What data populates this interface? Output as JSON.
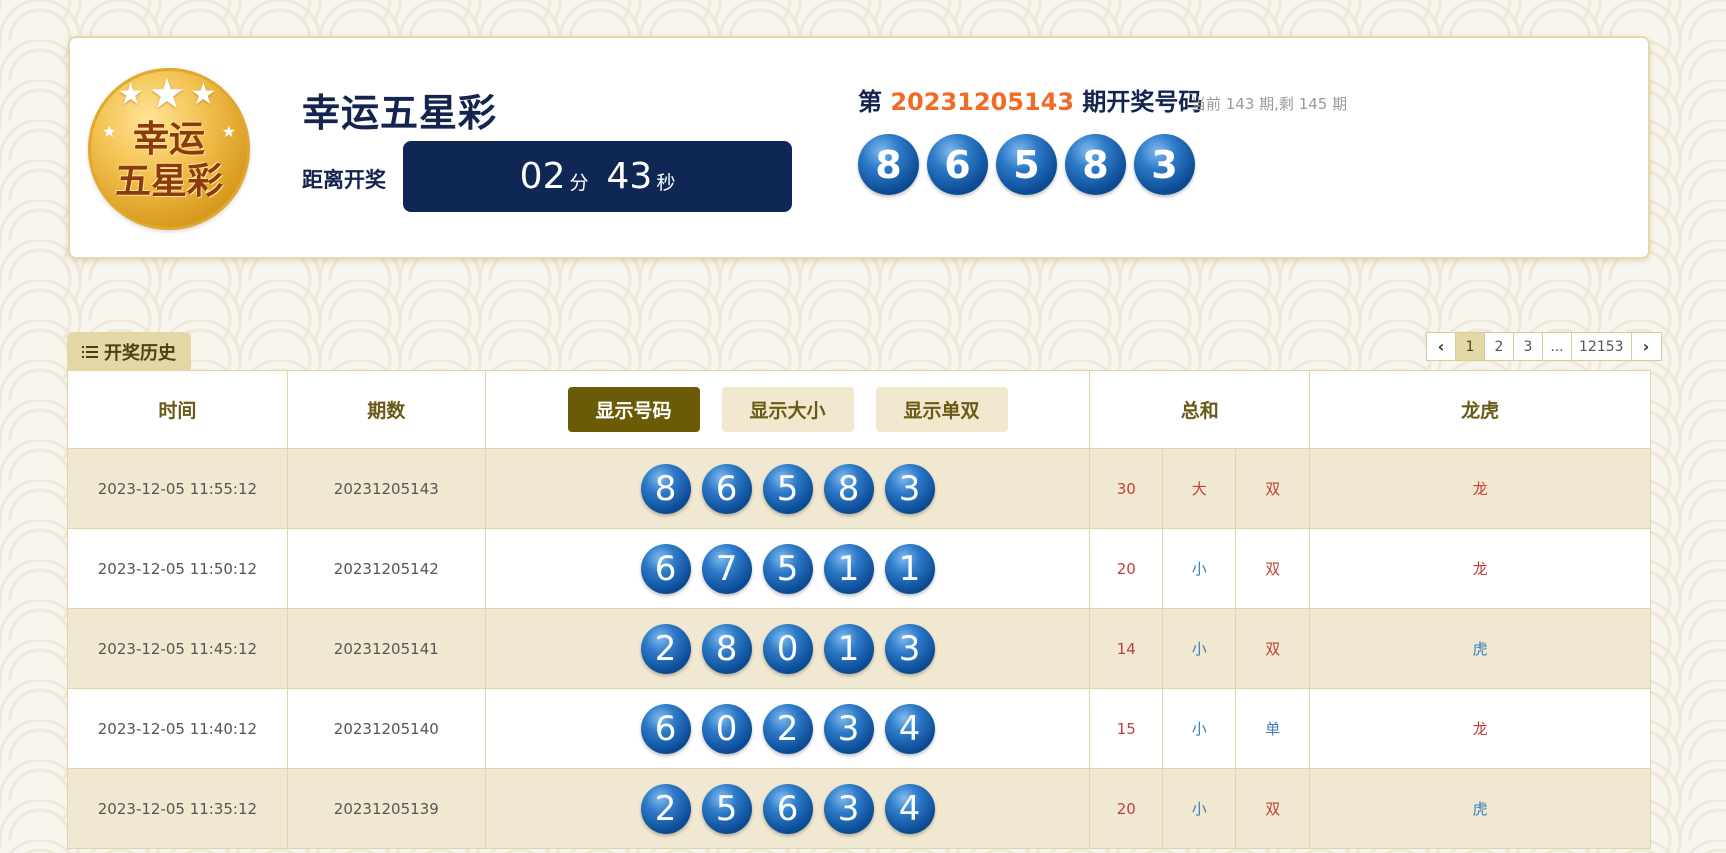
{
  "header": {
    "logo_text_line1": "幸运",
    "logo_text_line2": "五星彩",
    "title": "幸运五星彩",
    "countdown_label": "距离开奖",
    "countdown": {
      "minutes": "02",
      "minutes_unit": "分",
      "seconds": "43",
      "seconds_unit": "秒"
    },
    "draw_prefix": "第",
    "draw_issue": "20231205143",
    "draw_suffix": "期开奖号码",
    "draw_note": "当前 143 期,剩 145 期",
    "balls": [
      "8",
      "6",
      "5",
      "8",
      "3"
    ]
  },
  "history": {
    "tab_label": "开奖历史",
    "pagination": {
      "prev": "‹",
      "pages": [
        "1",
        "2",
        "3",
        "...",
        "12153"
      ],
      "active": "1",
      "next": "›"
    }
  },
  "table": {
    "headers": {
      "time": "时间",
      "issue": "期数",
      "btn_numbers": "显示号码",
      "btn_size": "显示大小",
      "btn_parity": "显示单双",
      "sum": "总和",
      "dragon_tiger": "龙虎"
    },
    "rows": [
      {
        "time": "2023-12-05 11:55:12",
        "issue": "20231205143",
        "balls": [
          "8",
          "6",
          "5",
          "8",
          "3"
        ],
        "sum": "30",
        "size": "大",
        "parity": "双",
        "dt": "龙"
      },
      {
        "time": "2023-12-05 11:50:12",
        "issue": "20231205142",
        "balls": [
          "6",
          "7",
          "5",
          "1",
          "1"
        ],
        "sum": "20",
        "size": "小",
        "parity": "双",
        "dt": "龙"
      },
      {
        "time": "2023-12-05 11:45:12",
        "issue": "20231205141",
        "balls": [
          "2",
          "8",
          "0",
          "1",
          "3"
        ],
        "sum": "14",
        "size": "小",
        "parity": "双",
        "dt": "虎"
      },
      {
        "time": "2023-12-05 11:40:12",
        "issue": "20231205140",
        "balls": [
          "6",
          "0",
          "2",
          "3",
          "4"
        ],
        "sum": "15",
        "size": "小",
        "parity": "单",
        "dt": "龙"
      },
      {
        "time": "2023-12-05 11:35:12",
        "issue": "20231205139",
        "balls": [
          "2",
          "5",
          "6",
          "3",
          "4"
        ],
        "sum": "20",
        "size": "小",
        "parity": "双",
        "dt": "虎"
      }
    ]
  },
  "colors": {
    "navy": "#0f2754",
    "gold_tab": "#e4d7a6",
    "active_button": "#6b5a06",
    "issue_orange": "#f26b24",
    "red_value": "#c43c3c",
    "blue_value": "#3a7fb8",
    "ball_blue": "#1a5fae"
  }
}
